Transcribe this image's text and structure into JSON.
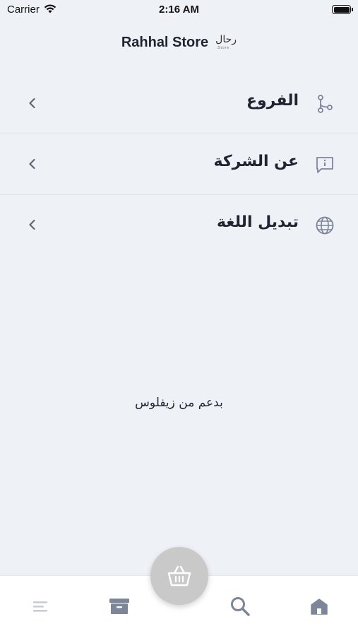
{
  "status_bar": {
    "carrier": "Carrier",
    "time": "2:16 AM"
  },
  "header": {
    "title": "Rahhal Store",
    "logo_text": "رحال",
    "logo_sub": "Store"
  },
  "menu": {
    "items": [
      {
        "label": "الفروع",
        "icon": "branches-icon"
      },
      {
        "label": "عن الشركة",
        "icon": "info-message-icon"
      },
      {
        "label": "تبديل اللغة",
        "icon": "globe-icon"
      }
    ]
  },
  "footer": {
    "powered_by": "بدعم من زيفلوس"
  },
  "tabbar": {
    "tabs": [
      "menu-icon",
      "orders-icon",
      "search-icon",
      "home-icon"
    ],
    "fab": "basket-icon"
  },
  "colors": {
    "background": "#eef1f6",
    "icon": "#7d8699",
    "fab": "#c9c9c9"
  }
}
